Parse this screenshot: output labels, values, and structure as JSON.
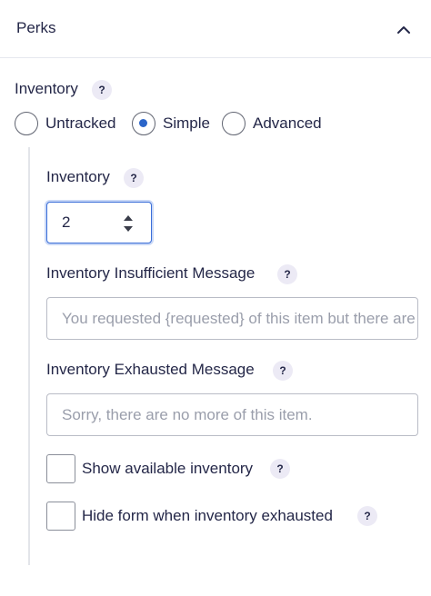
{
  "panel": {
    "title": "Perks",
    "collapse_icon": "chevron-up-icon"
  },
  "inventory_mode": {
    "label": "Inventory",
    "help": "?",
    "options": [
      {
        "label": "Untracked",
        "checked": false
      },
      {
        "label": "Simple",
        "checked": true
      },
      {
        "label": "Advanced",
        "checked": false
      }
    ]
  },
  "inventory_field": {
    "label": "Inventory",
    "help": "?",
    "value": "2"
  },
  "insufficient_message": {
    "label": "Inventory Insufficient Message",
    "help": "?",
    "placeholder": "You requested {requested} of this item but there are only {remaining} remaining."
  },
  "exhausted_message": {
    "label": "Inventory Exhausted Message",
    "help": "?",
    "placeholder": "Sorry, there are no more of this item."
  },
  "show_available": {
    "label": "Show available inventory",
    "help": "?",
    "checked": false
  },
  "hide_form": {
    "label": "Hide form when inventory exhausted",
    "help": "?",
    "checked": false
  },
  "colors": {
    "text": "#242748",
    "accent": "#2b65c9",
    "help_bg": "#eceaf5",
    "placeholder": "#9a9eab"
  }
}
